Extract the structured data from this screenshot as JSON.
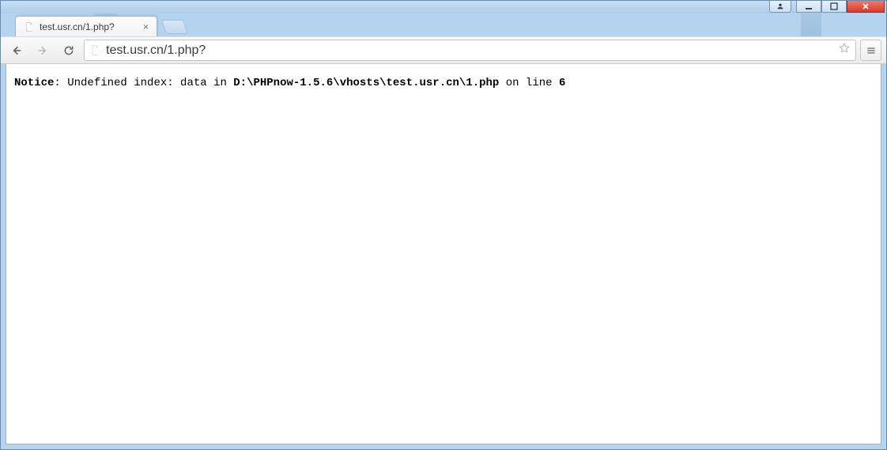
{
  "window": {
    "buttons": {
      "user": "user",
      "minimize": "minimize",
      "maximize": "maximize",
      "close": "close"
    }
  },
  "tab": {
    "title": "test.usr.cn/1.php?",
    "close_label": "×"
  },
  "toolbar": {
    "back_label": "Back",
    "forward_label": "Forward",
    "reload_label": "Reload",
    "menu_label": "Menu",
    "star_label": "Bookmark"
  },
  "omnibox": {
    "url": "test.usr.cn/1.php?",
    "placeholder": ""
  },
  "page": {
    "notice_label": "Notice",
    "message_before_path": ": Undefined index: data in ",
    "path": "D:\\PHPnow-1.5.6\\vhosts\\test.usr.cn\\1.php",
    "message_after_path": " on line ",
    "line_number": "6"
  }
}
